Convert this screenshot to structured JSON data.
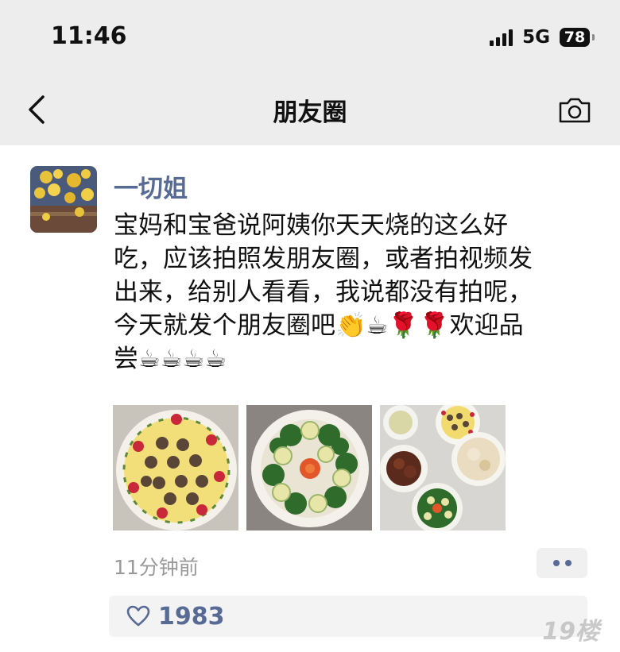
{
  "status_bar": {
    "time": "11:46",
    "network": "5G",
    "battery": "78"
  },
  "nav": {
    "title": "朋友圈",
    "back_icon": "chevron-left-icon",
    "camera_icon": "camera-icon"
  },
  "post": {
    "author": "一切姐",
    "text": "宝妈和宝爸说阿姨你天天烧的这么好\n吃，应该拍照发朋友圈，或者拍视频发\n出来，给别人看看，我说都没有拍呢，\n今天就发个朋友圈吧👏☕🌹🌹欢迎品\n尝☕☕☕☕",
    "photos": [
      {
        "name": "custard-dish-photo"
      },
      {
        "name": "broccoli-carrot-dish-photo"
      },
      {
        "name": "dinner-table-photo"
      }
    ],
    "time_ago": "11分钟前",
    "like_count": "1983"
  },
  "watermark": "19楼",
  "colors": {
    "link_blue": "#576b95",
    "header_bg": "#ededed",
    "likes_bg": "#f3f3f3"
  }
}
